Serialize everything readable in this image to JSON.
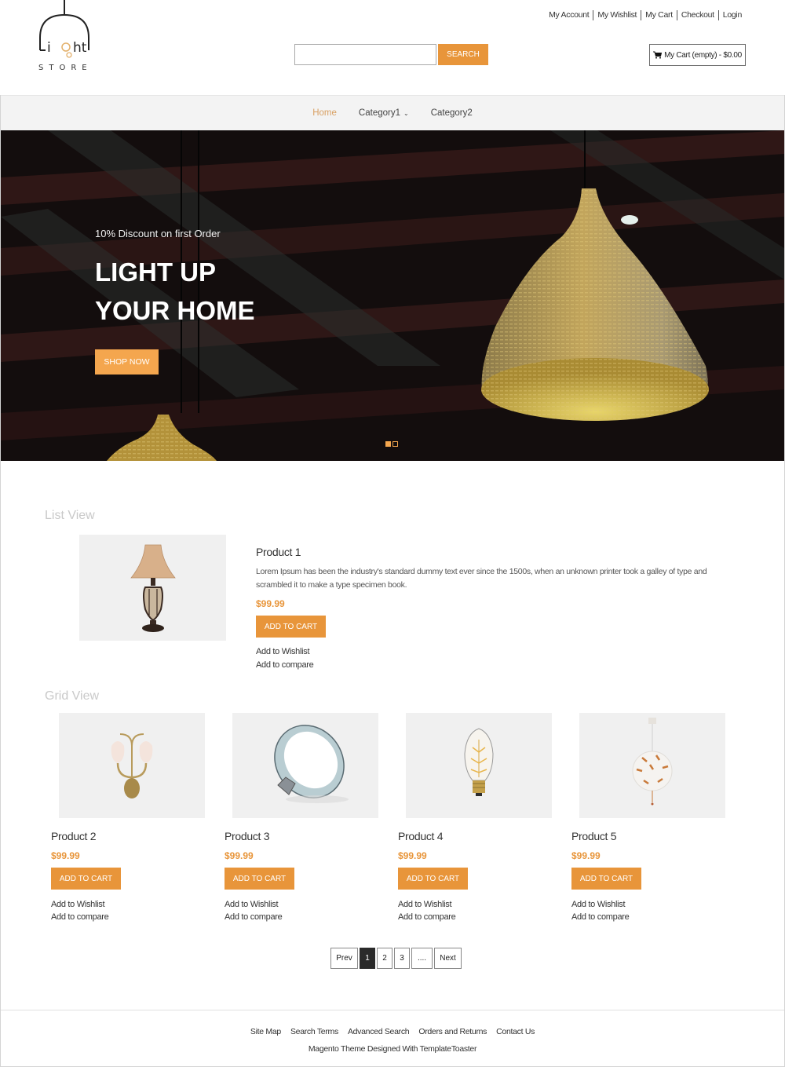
{
  "brand": {
    "logo_word": "Light",
    "logo_sub": "STORE"
  },
  "top_links": [
    "My Account",
    "My Wishlist",
    "My Cart",
    "Checkout",
    "Login"
  ],
  "search": {
    "placeholder": "",
    "value": "",
    "button_label": "SEARCH"
  },
  "cart": {
    "icon": "cart-icon",
    "label": "My Cart (empty) - $0.00"
  },
  "nav": {
    "items": [
      {
        "label": "Home",
        "active": true
      },
      {
        "label": "Category1",
        "has_dropdown": true
      },
      {
        "label": "Category2"
      }
    ]
  },
  "hero": {
    "subtitle": "10% Discount on first Order",
    "title_line1": "LIGHT UP",
    "title_line2": "YOUR HOME",
    "button_label": "SHOP NOW",
    "slides": 2,
    "active_slide": 1
  },
  "list_view": {
    "title": "List View",
    "product": {
      "name": "Product 1",
      "description": "Lorem Ipsum has been the industry's standard dummy text ever since the 1500s, when an unknown printer took a galley of type and scrambled it to make a type specimen book.",
      "price": "$99.99",
      "add_to_cart": "ADD TO CART",
      "wishlist": "Add to Wishlist",
      "compare": "Add to compare",
      "image": "table-lamp"
    }
  },
  "grid_view": {
    "title": "Grid View",
    "products": [
      {
        "name": "Product 2",
        "price": "$99.99",
        "add_to_cart": "ADD TO CART",
        "wishlist": "Add to Wishlist",
        "compare": "Add to compare",
        "image": "wall-sconce"
      },
      {
        "name": "Product 3",
        "price": "$99.99",
        "add_to_cart": "ADD TO CART",
        "wishlist": "Add to Wishlist",
        "compare": "Add to compare",
        "image": "led-panel"
      },
      {
        "name": "Product 4",
        "price": "$99.99",
        "add_to_cart": "ADD TO CART",
        "wishlist": "Add to Wishlist",
        "compare": "Add to compare",
        "image": "edison-bulb"
      },
      {
        "name": "Product 5",
        "price": "$99.99",
        "add_to_cart": "ADD TO CART",
        "wishlist": "Add to Wishlist",
        "compare": "Add to compare",
        "image": "pendant-globe"
      }
    ]
  },
  "pagination": {
    "prev": "Prev",
    "pages": [
      "1",
      "2",
      "3"
    ],
    "ellipsis": "....",
    "next": "Next",
    "current": "1"
  },
  "footer": {
    "links": [
      "Site Map",
      "Search Terms",
      "Advanced Search",
      "Orders and Returns",
      "Contact Us"
    ],
    "credit": "Magento Theme Designed With TemplateToaster"
  },
  "colors": {
    "accent": "#e8953a",
    "hero_button": "#f4a64e",
    "nav_active": "#d9a062",
    "nav_bg": "#f3f3f3",
    "section_title": "#c9c9c9"
  }
}
